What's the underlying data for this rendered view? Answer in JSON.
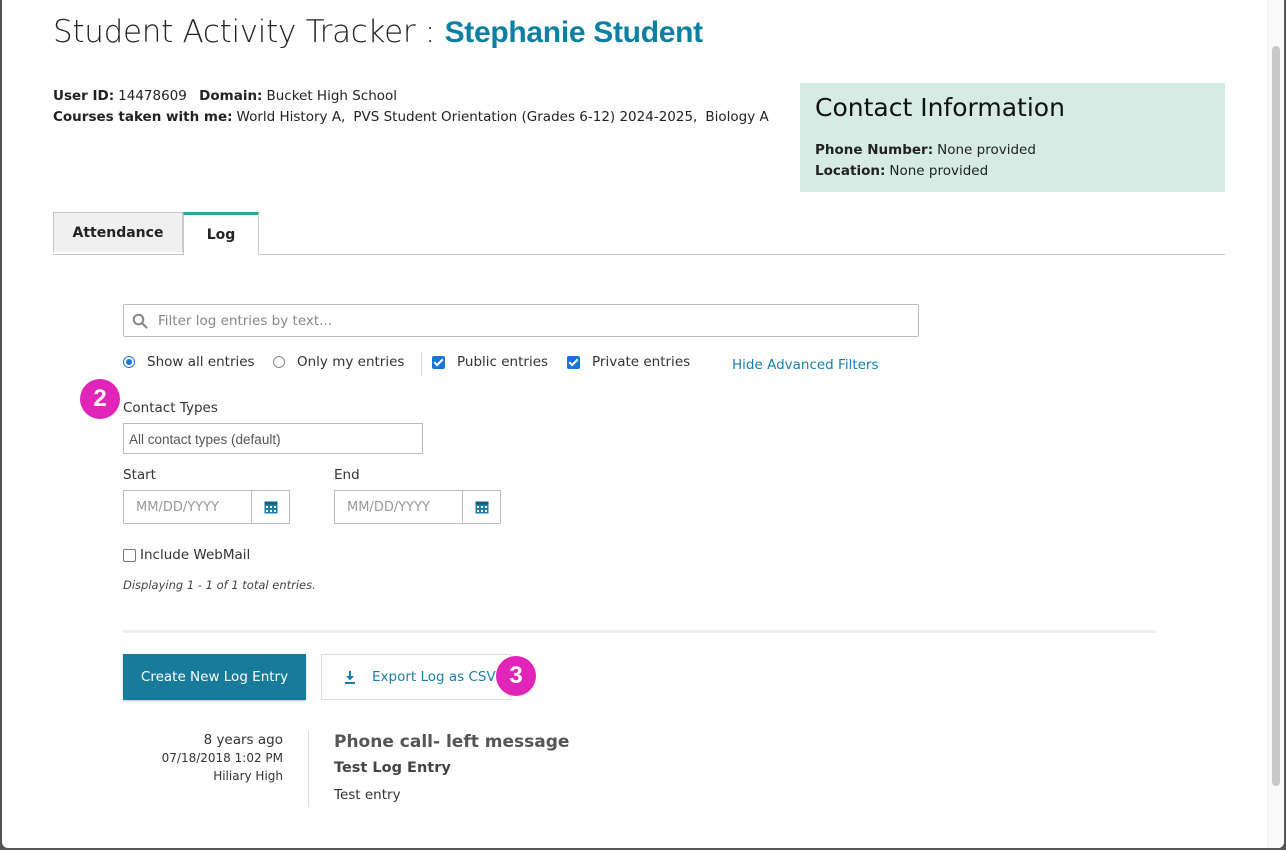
{
  "header": {
    "title": "Student Activity Tracker :",
    "student_name": "Stephanie Student"
  },
  "student_info": {
    "user_id_label": "User ID:",
    "user_id": "14478609",
    "domain_label": "Domain:",
    "domain": "Bucket High School",
    "courses_label": "Courses taken with me:",
    "courses": [
      "World History A,",
      "PVS Student Orientation (Grades 6-12) 2024-2025,",
      "Biology A"
    ]
  },
  "contact": {
    "title": "Contact Information",
    "phone_label": "Phone Number:",
    "phone": "None provided",
    "location_label": "Location:",
    "location": "None provided"
  },
  "tabs": [
    {
      "label": "Attendance",
      "active": false
    },
    {
      "label": "Log",
      "active": true
    }
  ],
  "filters": {
    "search_placeholder": "Filter log entries by text...",
    "show_all": "Show all entries",
    "only_mine": "Only my entries",
    "public": "Public entries",
    "private": "Private entries",
    "hide_advanced": "Hide Advanced Filters",
    "contact_types_label": "Contact Types",
    "contact_types_value": "All contact types (default)",
    "start_label": "Start",
    "end_label": "End",
    "date_placeholder": "MM/DD/YYYY",
    "include_webmail": "Include WebMail",
    "displaying": "Displaying 1 - 1 of 1 total entries."
  },
  "actions": {
    "create": "Create New Log Entry",
    "export": "Export Log as CSV"
  },
  "badges": {
    "two": "2",
    "three": "3"
  },
  "entry": {
    "ago": "8 years ago",
    "datetime": "07/18/2018 1:02 PM",
    "author": "Hiliary High",
    "type": "Phone call- left message",
    "subject": "Test Log Entry",
    "body": "Test entry"
  },
  "colors": {
    "accent": "#177c9c",
    "contact_bg": "#d5ebe4",
    "badge": "#e025b8",
    "tab_active": "#2aaa9a"
  }
}
